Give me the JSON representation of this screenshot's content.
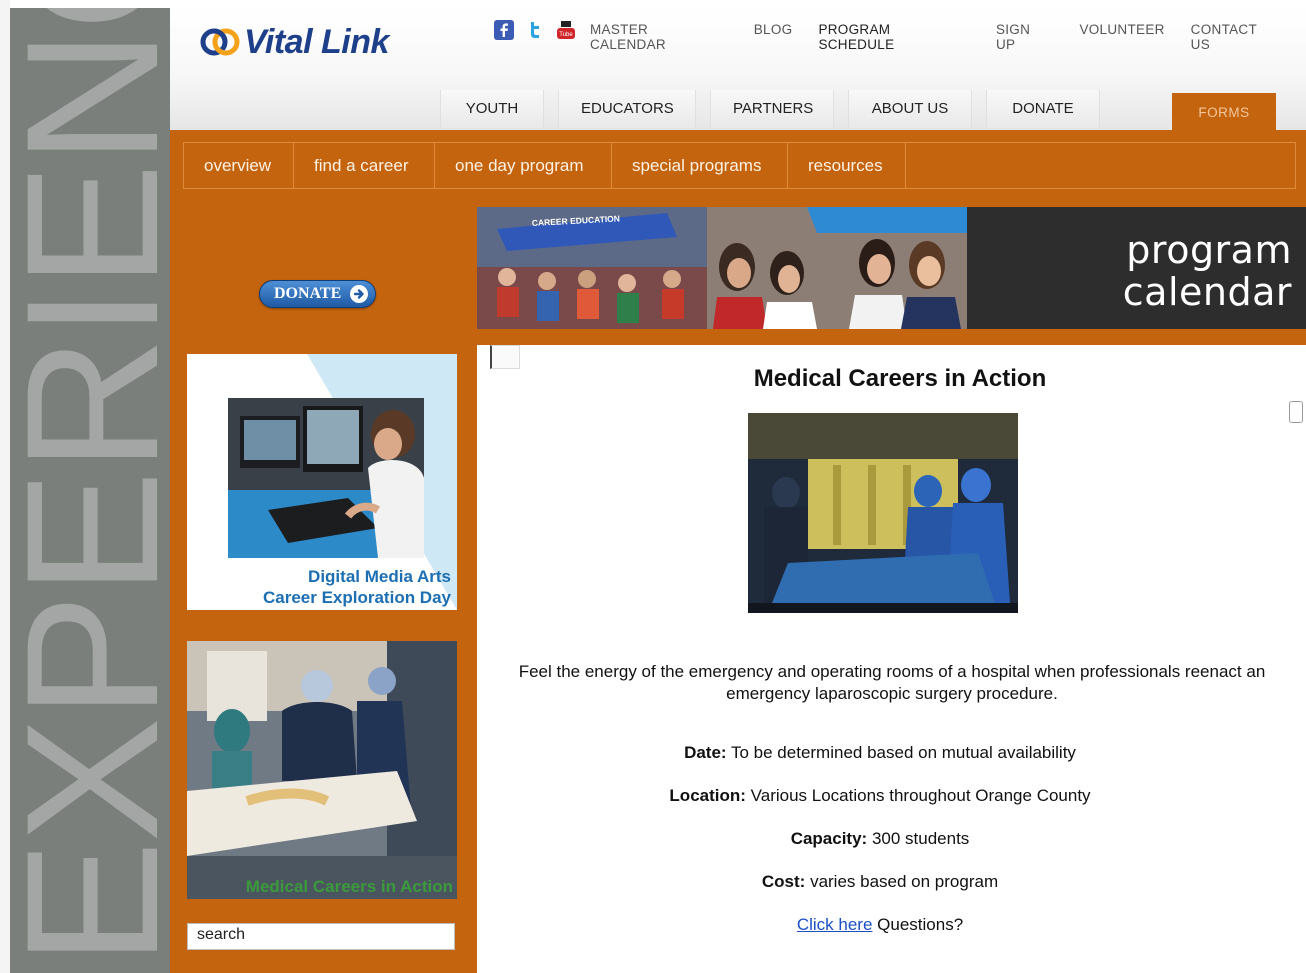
{
  "side": {
    "word": "EXPERIENCE"
  },
  "header": {
    "logo_text": "Vital Link",
    "social": [
      "facebook-icon",
      "twitter-icon",
      "youtube-icon"
    ],
    "utility_nav": [
      {
        "label": "MASTER CALENDAR"
      },
      {
        "label": "BLOG"
      },
      {
        "label": "PROGRAM SCHEDULE"
      },
      {
        "label": "SIGN UP"
      },
      {
        "label": "VOLUNTEER"
      },
      {
        "label": "CONTACT US"
      }
    ],
    "main_tabs": [
      {
        "label": "YOUTH"
      },
      {
        "label": "EDUCATORS"
      },
      {
        "label": "PARTNERS"
      },
      {
        "label": "ABOUT US"
      },
      {
        "label": "DONATE"
      }
    ],
    "forms_tab": "FORMS"
  },
  "subnav": [
    {
      "label": "overview"
    },
    {
      "label": "find a career"
    },
    {
      "label": "one day program"
    },
    {
      "label": "special programs"
    },
    {
      "label": "resources"
    }
  ],
  "sidebar": {
    "donate_label": "DONATE",
    "card1": {
      "line1": "Digital Media Arts",
      "line2": "Career Exploration Day"
    },
    "card2": {
      "caption": "Medical Careers in Action"
    },
    "search_value": "search"
  },
  "banner": {
    "sign_text": "CAREER EDUCATION",
    "title_line1": "program",
    "title_line2": "calendar"
  },
  "content": {
    "title": "Medical Careers in Action",
    "description": "Feel the energy of the emergency and operating rooms of a hospital when professionals reenact an emergency laparoscopic surgery procedure.",
    "details": [
      {
        "label": "Date:",
        "value": "To be determined based on mutual availability"
      },
      {
        "label": "Location:",
        "value": "Various Locations throughout Orange County"
      },
      {
        "label": "Capacity:",
        "value": "300 students"
      },
      {
        "label": "Cost:",
        "value": "varies based on program"
      }
    ],
    "link_text": "Click here",
    "link_suffix": "Questions?"
  },
  "colors": {
    "orange": "#c4640e",
    "logo_blue": "#1e3f8a",
    "side_gray": "#7b7f7c",
    "link_blue": "#1a4fc5"
  }
}
